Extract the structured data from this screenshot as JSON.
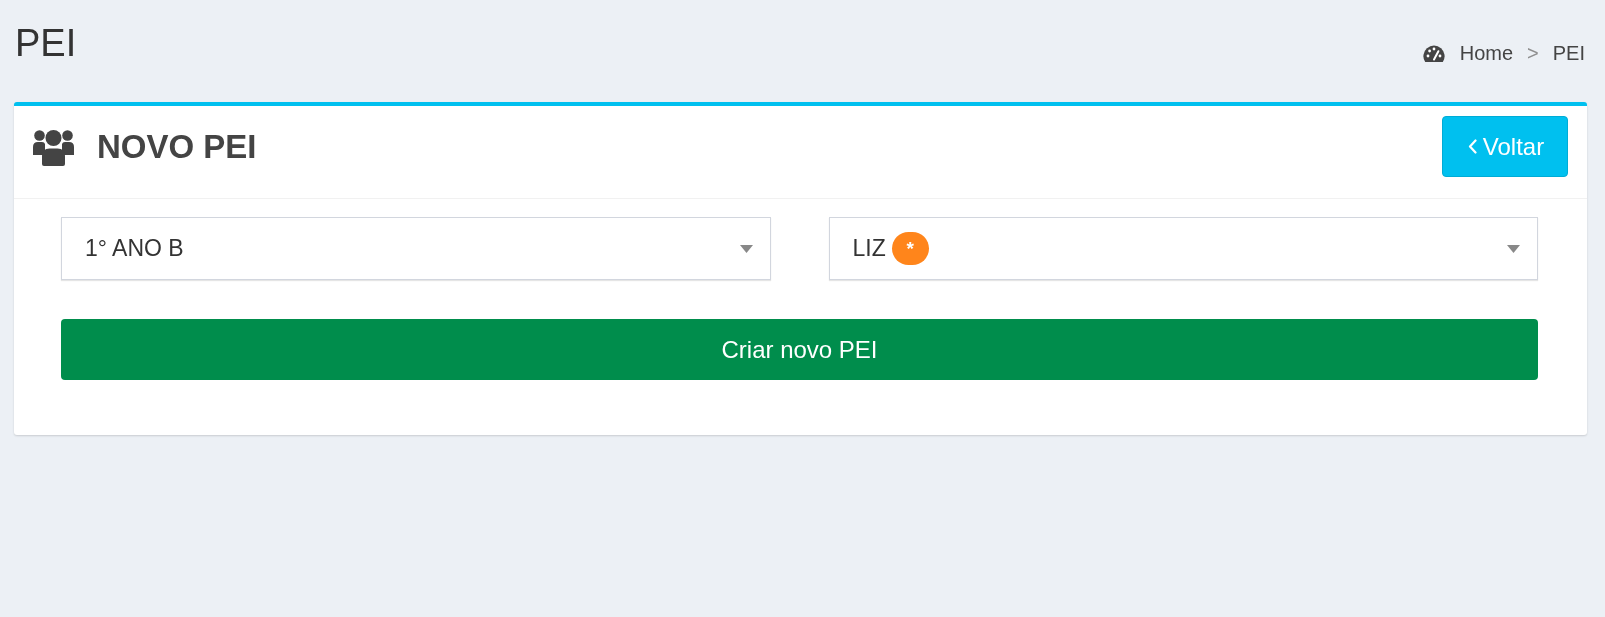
{
  "page_header": {
    "title": "PEI",
    "breadcrumb": {
      "separator": ">",
      "items": [
        {
          "kind": "home",
          "label": "Home"
        },
        {
          "kind": "current",
          "label": "PEI"
        }
      ]
    }
  },
  "card": {
    "title": "NOVO PEI",
    "back_button": "Voltar",
    "selects": [
      {
        "value": "1° ANO B"
      },
      {
        "value": "LIZ",
        "badge": "*"
      }
    ],
    "submit_button": "Criar novo PEI"
  }
}
